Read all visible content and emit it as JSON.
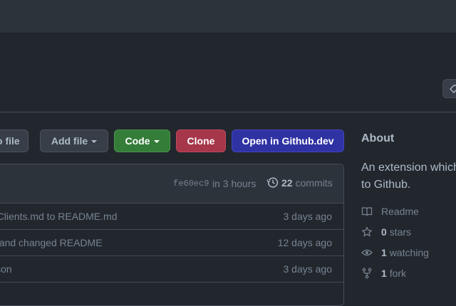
{
  "toolbar": {
    "go_to_file_label": "o file",
    "add_file_label": "Add file",
    "code_label": "Code",
    "clone_label": "Clone",
    "open_dev_label": "Open in Github.dev"
  },
  "latest_commit": {
    "sha": "fe60ec9",
    "time": "in 3 hours",
    "commits_count": "22",
    "commits_label": "commits"
  },
  "files": [
    {
      "message": "-Clients.md to README.md",
      "age": "3 days ago"
    },
    {
      "message": "t and changed README",
      "age": "12 days ago"
    },
    {
      "message": "json",
      "age": "3 days ago"
    }
  ],
  "about": {
    "title": "About",
    "description": "An extension which to Github.",
    "readme": "Readme",
    "stars_count": "0",
    "stars_label": "stars",
    "watching_count": "1",
    "watching_label": "watching",
    "fork_count": "1",
    "fork_label": "fork"
  },
  "icons": [
    "tag-icon",
    "history-icon",
    "book-icon",
    "star-icon",
    "eye-icon",
    "fork-icon"
  ],
  "colors": {
    "background": "#22272e",
    "code_button": "#347d39",
    "clone_button": "#a6364a",
    "open_dev_button": "#2f32a3"
  }
}
